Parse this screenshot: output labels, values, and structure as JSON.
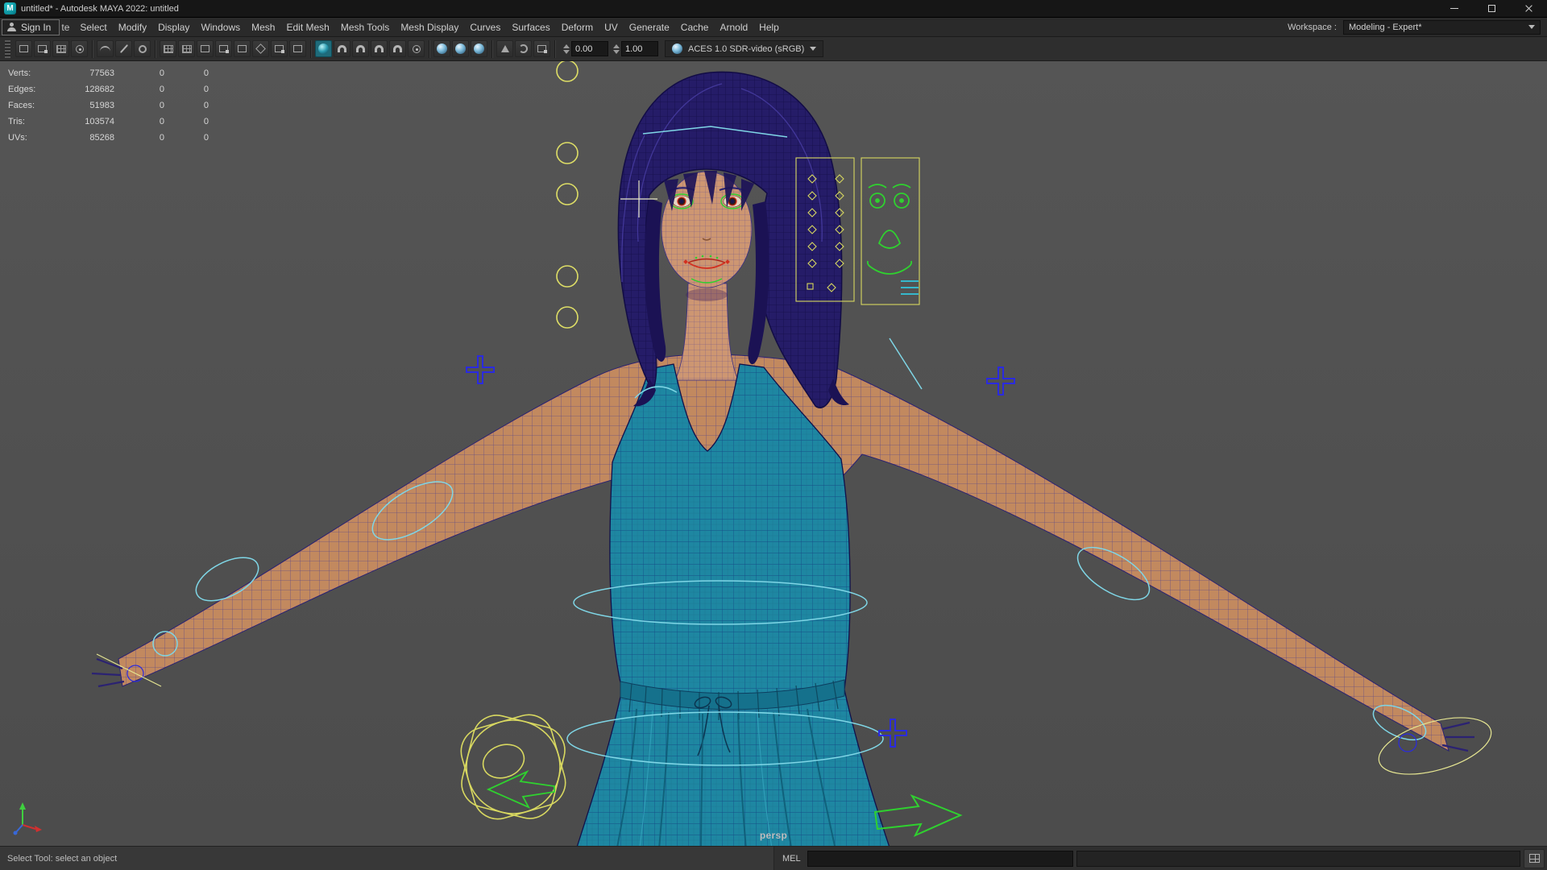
{
  "window": {
    "logo_letter": "M",
    "title": "untitled* - Autodesk MAYA 2022: untitled"
  },
  "menu": {
    "signin_label": "Sign In",
    "items": [
      "te",
      "Select",
      "Modify",
      "Display",
      "Windows",
      "Mesh",
      "Edit Mesh",
      "Mesh Tools",
      "Mesh Display",
      "Curves",
      "Surfaces",
      "Deform",
      "UV",
      "Generate",
      "Cache",
      "Arnold",
      "Help"
    ],
    "workspace_label": "Workspace :",
    "workspace_value": "Modeling - Expert*"
  },
  "toolbar": {
    "field1": "0.00",
    "field2": "1.00",
    "colorspace": "ACES 1.0 SDR-video (sRGB)",
    "icon_names": [
      "select-by-hierarchy",
      "select-by-object",
      "select-by-component",
      "highlight-selection",
      "lasso-select",
      "paint-select",
      "soft-select",
      "snap-to-grids",
      "snap-to-curves",
      "snap-to-points",
      "snap-to-projected-center",
      "snap-to-view-planes",
      "make-live",
      "construction-history",
      "render-settings",
      "exposure-toggle"
    ]
  },
  "hud": {
    "rows": [
      {
        "label": "Verts:",
        "value": "77563",
        "sel": "0",
        "extra": "0"
      },
      {
        "label": "Edges:",
        "value": "128682",
        "sel": "0",
        "extra": "0"
      },
      {
        "label": "Faces:",
        "value": "51983",
        "sel": "0",
        "extra": "0"
      },
      {
        "label": "Tris:",
        "value": "103574",
        "sel": "0",
        "extra": "0"
      },
      {
        "label": "UVs:",
        "value": "85268",
        "sel": "0",
        "extra": "0"
      }
    ]
  },
  "viewport": {
    "camera_label": "persp"
  },
  "statusbar": {
    "helpline": "Select Tool: select an object",
    "mel_label": "MEL"
  },
  "colors": {
    "accent_teal": "#0b9aa2",
    "dress_teal": "#1e87a2",
    "skin": "#c2895f",
    "hair_navy": "#251c68",
    "rig_yellow": "#d8d860",
    "rig_green": "#2fd12f",
    "rig_cyan": "#7fd6e6",
    "rig_blue": "#2a2ae0"
  }
}
